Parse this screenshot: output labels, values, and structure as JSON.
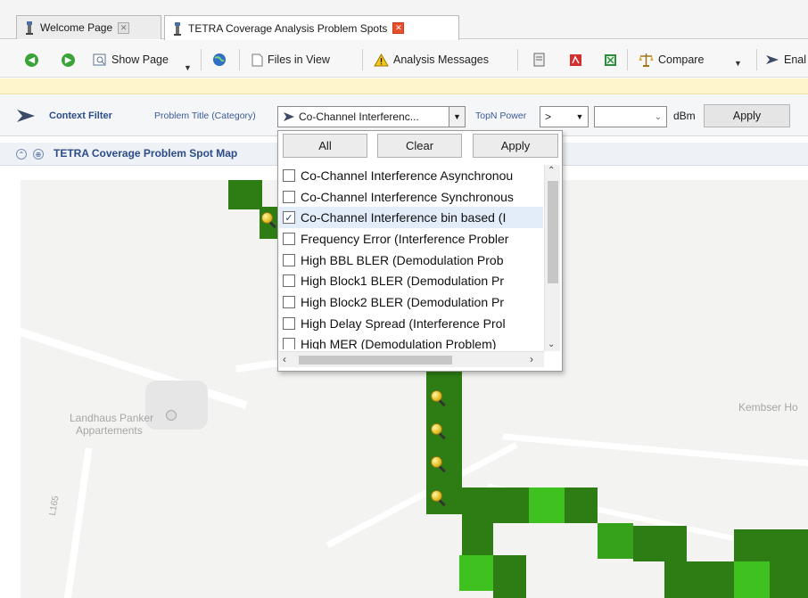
{
  "tabs": [
    {
      "label": "Welcome Page",
      "active": false
    },
    {
      "label": "TETRA Coverage Analysis Problem Spots",
      "active": true
    }
  ],
  "toolbar": {
    "show_page": "Show Page",
    "files_in_view": "Files in View",
    "analysis_messages": "Analysis Messages",
    "compare": "Compare",
    "enable": "Enal"
  },
  "filter": {
    "context_filter": "Context Filter",
    "problem_title_label": "Problem Title (Category)",
    "problem_title_value": "Co-Channel Interferenc...",
    "topn_label": "TopN Power",
    "operator_value": ">",
    "power_value": "",
    "unit": "dBm",
    "apply": "Apply"
  },
  "dropdown": {
    "all": "All",
    "clear": "Clear",
    "apply": "Apply",
    "items": [
      {
        "label": "Co-Channel Interference Asynchronou",
        "checked": false
      },
      {
        "label": "Co-Channel Interference Synchronous",
        "checked": false
      },
      {
        "label": "Co-Channel Interference bin based (I",
        "checked": true
      },
      {
        "label": "Frequency Error (Interference Probler",
        "checked": false
      },
      {
        "label": "High BBL BLER (Demodulation Prob",
        "checked": false
      },
      {
        "label": "High Block1 BLER (Demodulation Pr",
        "checked": false
      },
      {
        "label": "High Block2 BLER (Demodulation Pr",
        "checked": false
      },
      {
        "label": "High Delay Spread (Interference Prol",
        "checked": false
      },
      {
        "label": "High MER (Demodulation Problem)",
        "checked": false
      }
    ]
  },
  "map_panel": {
    "title": "TETRA Coverage Problem Spot Map"
  },
  "map_labels": {
    "landhaus": "Landhaus Panker",
    "appartements": "Appartements",
    "kembser": "Kembser Ho",
    "road_l165": "L165"
  },
  "colors": {
    "dark_green": "#2e7d14",
    "mid_green": "#36a11a",
    "light_green": "#3fc21f",
    "accent_blue": "#2b4c8a",
    "close_red": "#e84e2b"
  }
}
